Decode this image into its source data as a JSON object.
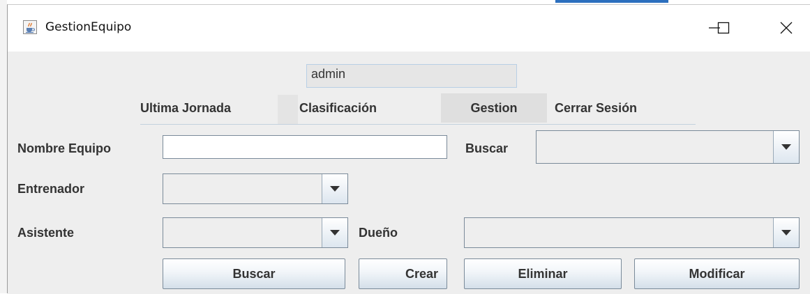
{
  "window": {
    "title": "GestionEquipo",
    "controls": {
      "minimize": "—",
      "maximize": "☐",
      "close": "✕"
    },
    "app_icon": "java-cup-icon"
  },
  "header": {
    "user": "admin",
    "nav": [
      "Ultima Jornada",
      "Clasificación",
      "Gestion",
      "Cerrar Sesión"
    ]
  },
  "form": {
    "nombre_equipo_label": "Nombre  Equipo",
    "nombre_equipo_value": "",
    "buscar_label": "Buscar",
    "buscar_value": "",
    "entrenador_label": "Entrenador",
    "entrenador_value": "",
    "asistente_label": "Asistente",
    "asistente_value": "",
    "dueno_label": "Dueño",
    "dueno_value": ""
  },
  "actions": {
    "buscar": "Buscar",
    "crear": "Crear",
    "eliminar": "Eliminar",
    "modificar": "Modificar"
  },
  "colors": {
    "window_bg": "#eeeeee",
    "titlebar_bg": "#ffffff",
    "field_border": "#7a8a99",
    "text": "#333333"
  }
}
